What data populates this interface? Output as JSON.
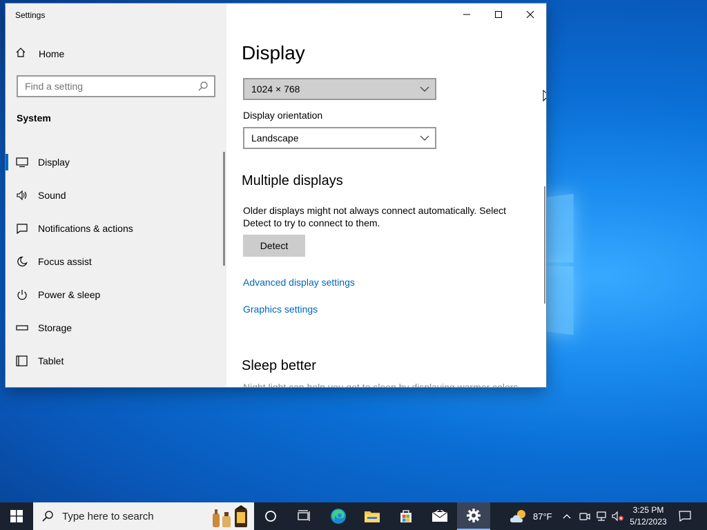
{
  "window": {
    "title": "Settings",
    "controls": {
      "minimize": "minimize",
      "maximize": "maximize",
      "close": "close"
    }
  },
  "sidebar": {
    "home_label": "Home",
    "search_placeholder": "Find a setting",
    "section_label": "System",
    "items": [
      {
        "label": "Display",
        "icon": "monitor-icon",
        "active": true
      },
      {
        "label": "Sound",
        "icon": "speaker-icon"
      },
      {
        "label": "Notifications & actions",
        "icon": "notification-icon"
      },
      {
        "label": "Focus assist",
        "icon": "moon-icon"
      },
      {
        "label": "Power & sleep",
        "icon": "power-icon"
      },
      {
        "label": "Storage",
        "icon": "storage-icon"
      },
      {
        "label": "Tablet",
        "icon": "tablet-icon"
      }
    ]
  },
  "main": {
    "title": "Display",
    "resolution_value": "1024 × 768",
    "orientation_label": "Display orientation",
    "orientation_value": "Landscape",
    "multiple_heading": "Multiple displays",
    "multiple_desc": "Older displays might not always connect automatically. Select Detect to try to connect to them.",
    "detect_button": "Detect",
    "advanced_link": "Advanced display settings",
    "graphics_link": "Graphics settings",
    "sleep_heading": "Sleep better",
    "sleep_desc": "Night light can help you get to sleep by displaying warmer colors"
  },
  "taskbar": {
    "search_placeholder": "Type here to search",
    "weather_temp": "87°F",
    "time": "3:25 PM",
    "date": "5/12/2023",
    "accent": "#8ab4f8"
  }
}
